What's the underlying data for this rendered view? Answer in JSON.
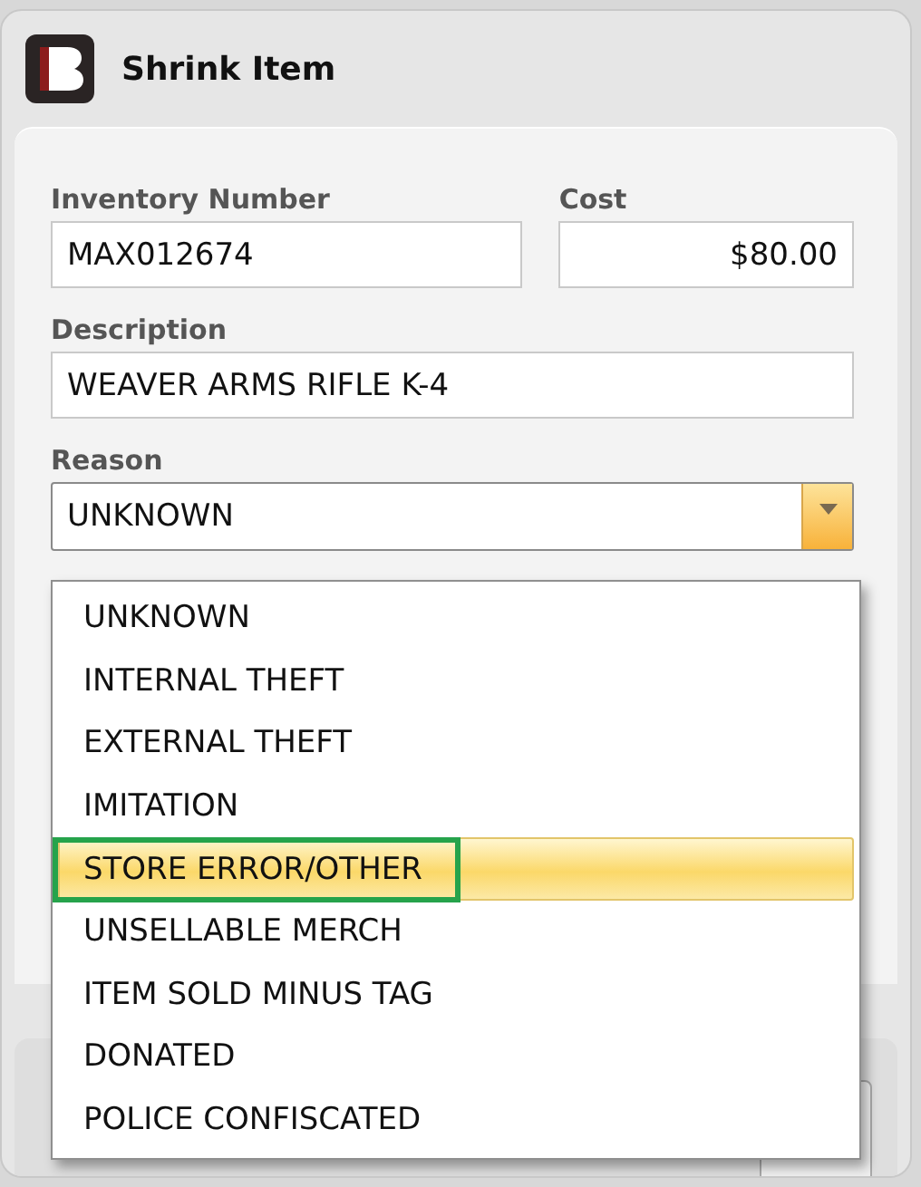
{
  "window": {
    "title": "Shrink Item"
  },
  "fields": {
    "inventory_number": {
      "label": "Inventory Number",
      "value": "MAX012674"
    },
    "cost": {
      "label": "Cost",
      "value": "$80.00"
    },
    "description": {
      "label": "Description",
      "value": "WEAVER ARMS RIFLE K-4"
    }
  },
  "reason": {
    "label": "Reason",
    "value": "UNKNOWN",
    "expanded": true,
    "options": [
      {
        "label": "UNKNOWN",
        "highlighted": false,
        "outlined": false
      },
      {
        "label": "INTERNAL THEFT",
        "highlighted": false,
        "outlined": false
      },
      {
        "label": "EXTERNAL THEFT",
        "highlighted": false,
        "outlined": false
      },
      {
        "label": "IMITATION",
        "highlighted": false,
        "outlined": false
      },
      {
        "label": "STORE ERROR/OTHER",
        "highlighted": true,
        "outlined": true
      },
      {
        "label": "UNSELLABLE MERCH",
        "highlighted": false,
        "outlined": false
      },
      {
        "label": "ITEM SOLD MINUS TAG",
        "highlighted": false,
        "outlined": false
      },
      {
        "label": "DONATED",
        "highlighted": false,
        "outlined": false
      },
      {
        "label": "POLICE CONFISCATED",
        "highlighted": false,
        "outlined": false
      }
    ]
  }
}
